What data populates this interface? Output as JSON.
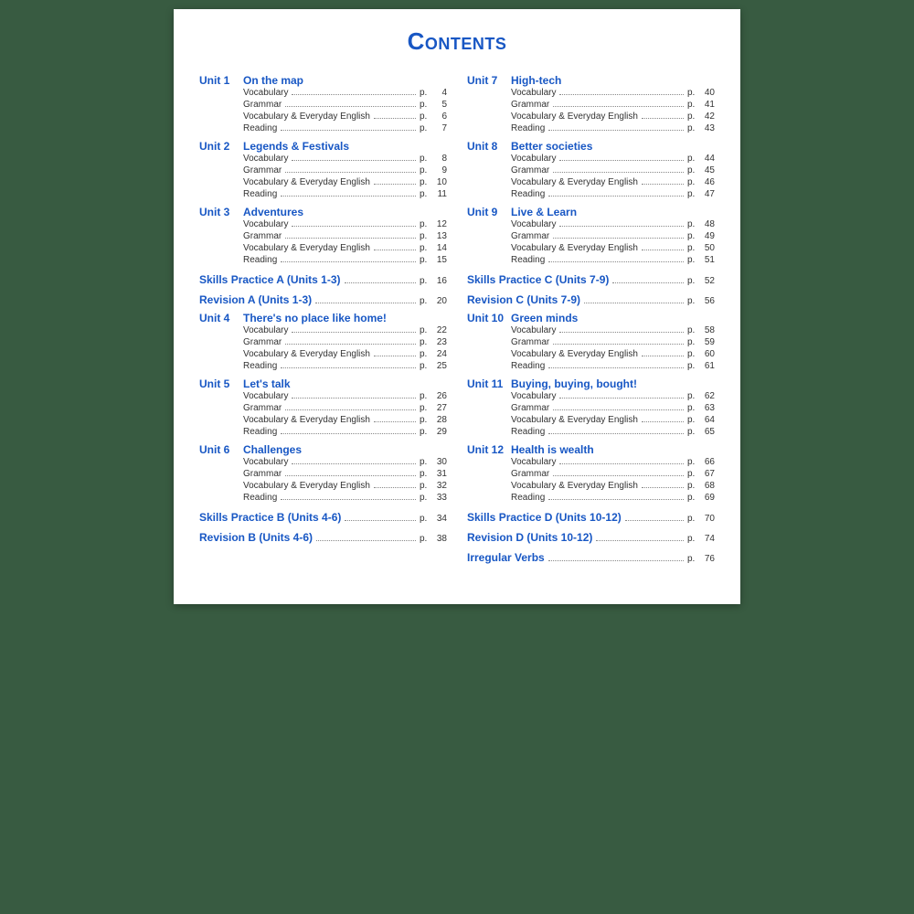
{
  "title": "Contents",
  "p_label": "p.",
  "columns": [
    [
      {
        "type": "unit",
        "unit": "Unit 1",
        "title": "On the map",
        "items": [
          {
            "label": "Vocabulary",
            "page": "4"
          },
          {
            "label": "Grammar",
            "page": "5"
          },
          {
            "label": "Vocabulary & Everyday English",
            "page": "6"
          },
          {
            "label": "Reading",
            "page": "7"
          }
        ]
      },
      {
        "type": "unit",
        "unit": "Unit 2",
        "title": "Legends & Festivals",
        "items": [
          {
            "label": "Vocabulary",
            "page": "8"
          },
          {
            "label": "Grammar",
            "page": "9"
          },
          {
            "label": "Vocabulary & Everyday English",
            "page": "10"
          },
          {
            "label": "Reading",
            "page": "11"
          }
        ]
      },
      {
        "type": "unit",
        "unit": "Unit 3",
        "title": "Adventures",
        "items": [
          {
            "label": "Vocabulary",
            "page": "12"
          },
          {
            "label": "Grammar",
            "page": "13"
          },
          {
            "label": "Vocabulary & Everyday English",
            "page": "14"
          },
          {
            "label": "Reading",
            "page": "15"
          }
        ]
      },
      {
        "type": "special",
        "label": "Skills Practice A (Units 1-3)",
        "page": "16"
      },
      {
        "type": "special",
        "label": "Revision A (Units 1-3)",
        "page": "20"
      },
      {
        "type": "unit",
        "unit": "Unit 4",
        "title": "There's no place like home!",
        "items": [
          {
            "label": "Vocabulary",
            "page": "22"
          },
          {
            "label": "Grammar",
            "page": "23"
          },
          {
            "label": "Vocabulary & Everyday English",
            "page": "24"
          },
          {
            "label": "Reading",
            "page": "25"
          }
        ]
      },
      {
        "type": "unit",
        "unit": "Unit 5",
        "title": "Let's talk",
        "items": [
          {
            "label": "Vocabulary",
            "page": "26"
          },
          {
            "label": "Grammar",
            "page": "27"
          },
          {
            "label": "Vocabulary & Everyday English",
            "page": "28"
          },
          {
            "label": "Reading",
            "page": "29"
          }
        ]
      },
      {
        "type": "unit",
        "unit": "Unit 6",
        "title": "Challenges",
        "items": [
          {
            "label": "Vocabulary",
            "page": "30"
          },
          {
            "label": "Grammar",
            "page": "31"
          },
          {
            "label": "Vocabulary & Everyday English",
            "page": "32"
          },
          {
            "label": "Reading",
            "page": "33"
          }
        ]
      },
      {
        "type": "special",
        "label": "Skills Practice B (Units 4-6)",
        "page": "34"
      },
      {
        "type": "special",
        "label": "Revision B (Units 4-6)",
        "page": "38"
      }
    ],
    [
      {
        "type": "unit",
        "unit": "Unit 7",
        "title": "High-tech",
        "items": [
          {
            "label": "Vocabulary",
            "page": "40"
          },
          {
            "label": "Grammar",
            "page": "41"
          },
          {
            "label": "Vocabulary & Everyday English",
            "page": "42"
          },
          {
            "label": "Reading",
            "page": "43"
          }
        ]
      },
      {
        "type": "unit",
        "unit": "Unit 8",
        "title": "Better societies",
        "items": [
          {
            "label": "Vocabulary",
            "page": "44"
          },
          {
            "label": "Grammar",
            "page": "45"
          },
          {
            "label": "Vocabulary & Everyday English",
            "page": "46"
          },
          {
            "label": "Reading",
            "page": "47"
          }
        ]
      },
      {
        "type": "unit",
        "unit": "Unit 9",
        "title": "Live & Learn",
        "items": [
          {
            "label": "Vocabulary",
            "page": "48"
          },
          {
            "label": "Grammar",
            "page": "49"
          },
          {
            "label": "Vocabulary & Everyday English",
            "page": "50"
          },
          {
            "label": "Reading",
            "page": "51"
          }
        ]
      },
      {
        "type": "special",
        "label": "Skills Practice C (Units 7-9)",
        "page": "52"
      },
      {
        "type": "special",
        "label": "Revision C (Units 7-9)",
        "page": "56"
      },
      {
        "type": "unit",
        "unit": "Unit 10",
        "title": "Green minds",
        "items": [
          {
            "label": "Vocabulary",
            "page": "58"
          },
          {
            "label": "Grammar",
            "page": "59"
          },
          {
            "label": "Vocabulary & Everyday English",
            "page": "60"
          },
          {
            "label": "Reading",
            "page": "61"
          }
        ]
      },
      {
        "type": "unit",
        "unit": "Unit 11",
        "title": "Buying, buying, bought!",
        "items": [
          {
            "label": "Vocabulary",
            "page": "62"
          },
          {
            "label": "Grammar",
            "page": "63"
          },
          {
            "label": "Vocabulary & Everyday English",
            "page": "64"
          },
          {
            "label": "Reading",
            "page": "65"
          }
        ]
      },
      {
        "type": "unit",
        "unit": "Unit 12",
        "title": "Health is wealth",
        "items": [
          {
            "label": "Vocabulary",
            "page": "66"
          },
          {
            "label": "Grammar",
            "page": "67"
          },
          {
            "label": "Vocabulary & Everyday English",
            "page": "68"
          },
          {
            "label": "Reading",
            "page": "69"
          }
        ]
      },
      {
        "type": "special",
        "label": "Skills Practice D (Units 10-12)",
        "page": "70"
      },
      {
        "type": "special",
        "label": "Revision D (Units 10-12)",
        "page": "74"
      },
      {
        "type": "special",
        "label": "Irregular Verbs",
        "page": "76"
      }
    ]
  ]
}
